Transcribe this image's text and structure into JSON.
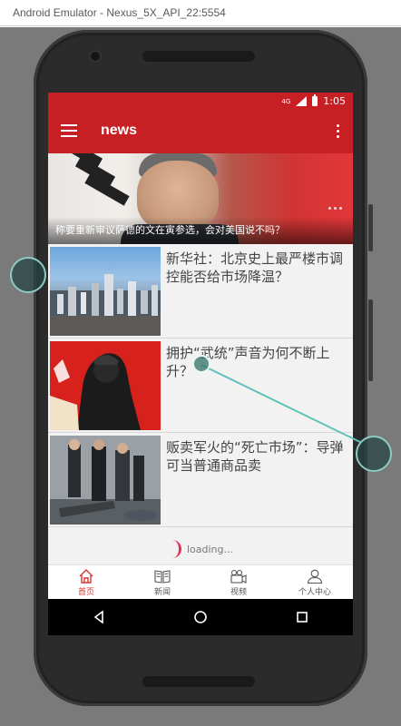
{
  "emulator": {
    "title": "Android Emulator - Nexus_5X_API_22:5554"
  },
  "status_bar": {
    "network": "4G",
    "time": "1:05"
  },
  "app_bar": {
    "title": "news",
    "menu_icon": "hamburger-icon",
    "more_icon": "more-vert-icon"
  },
  "banner": {
    "caption": "称要重新审议萨德的文在寅参选，会对美国说不吗？"
  },
  "news": [
    {
      "title": "新华社：北京史上最严楼市调控能否给市场降温？",
      "image": "city-skyline"
    },
    {
      "title": "拥护“武统”声音为何不断上升？",
      "image": "propaganda-poster"
    },
    {
      "title": "贩卖军火的“死亡市场”：导弹可当普通商品卖",
      "image": "weapons-dealers"
    }
  ],
  "loading": {
    "text": "loading..."
  },
  "bottom_nav": {
    "items": [
      {
        "label": "首页",
        "icon": "home-icon",
        "active": true
      },
      {
        "label": "新闻",
        "icon": "newspaper-icon",
        "active": false
      },
      {
        "label": "视频",
        "icon": "video-camera-icon",
        "active": false
      },
      {
        "label": "个人中心",
        "icon": "person-icon",
        "active": false
      }
    ]
  },
  "colors": {
    "primary": "#c62025",
    "active_tab": "#d9332f",
    "spinner": "#e03355",
    "touch_indicator": "#5fc2b8"
  }
}
